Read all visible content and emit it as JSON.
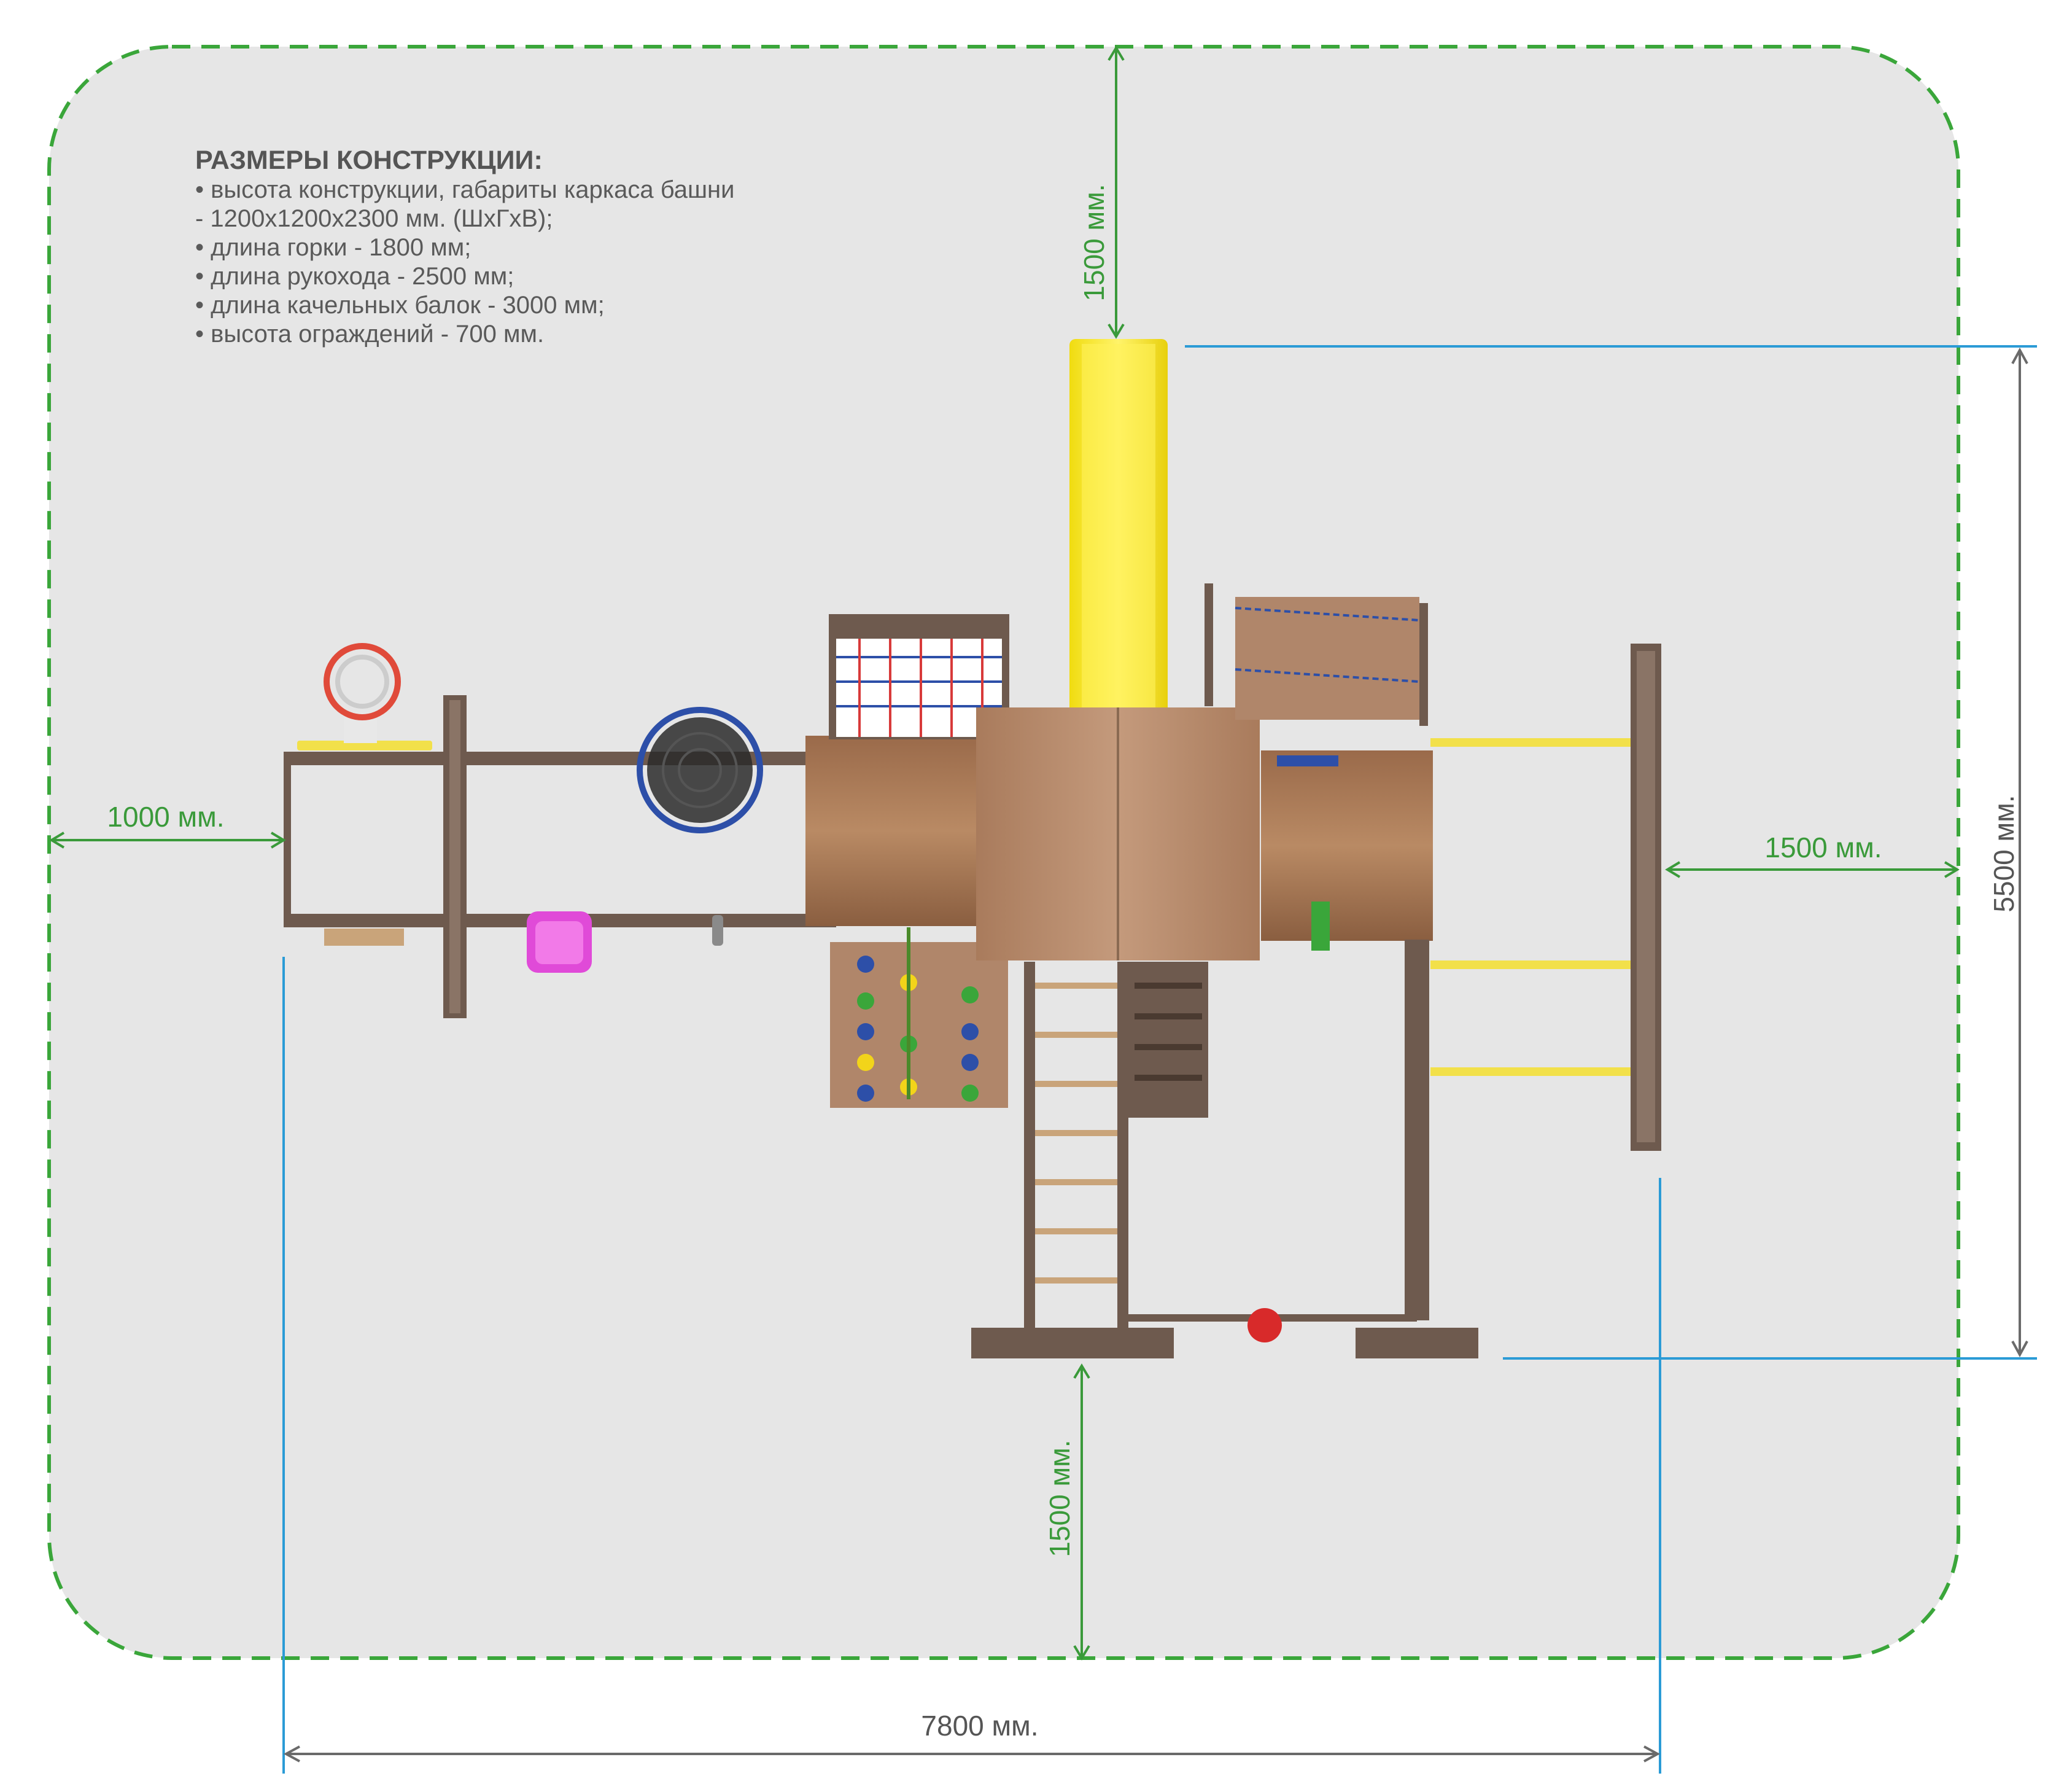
{
  "specs": {
    "title": "РАЗМЕРЫ КОНСТРУКЦИИ:",
    "items": [
      "•      высота конструкции, габариты каркаса башни",
      "- 1200х1200х2300 мм. (ШхГхВ);",
      "•      длина горки - 1800 мм;",
      "•      длина рукохода - 2500 мм;",
      "•      длина качельных балок - 3000 мм;",
      "•      высота ограждений - 700 мм."
    ]
  },
  "dimensions": {
    "top_clearance": "1500 мм.",
    "bottom_clearance": "1500 мм.",
    "left_clearance": "1000 мм.",
    "right_clearance": "1500 мм.",
    "overall_depth": "5500 мм.",
    "overall_width": "7800 мм."
  },
  "colors": {
    "zone_border": "#3aa63a",
    "zone_fill": "#e6e6e6",
    "dimension_green": "#3a9a3a",
    "dimension_blue": "#2b9bd6",
    "wood_frame": "#6e5a4e",
    "deck": "#b0866a",
    "slide": "#f5e51c"
  }
}
